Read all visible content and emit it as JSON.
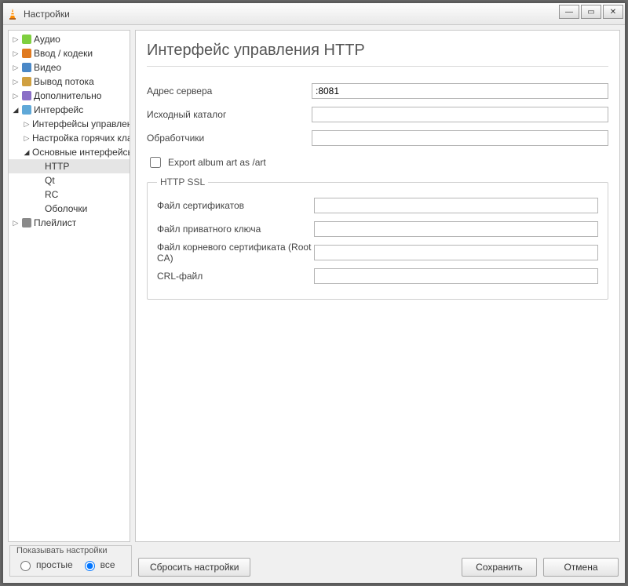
{
  "window": {
    "title": "Настройки"
  },
  "sysbuttons": {
    "min": "—",
    "max": "▭",
    "close": "✕"
  },
  "tree": {
    "audio": "Аудио",
    "input": "Ввод / кодеки",
    "video": "Видео",
    "sout": "Вывод потока",
    "advanced": "Дополнительно",
    "interface": "Интерфейс",
    "intf_sub1": "Интерфейсы управления",
    "intf_sub2": "Настройка горячих клавиш",
    "intf_sub3": "Основные интерфейсы",
    "http": "HTTP",
    "qt": "Qt",
    "rc": "RC",
    "skins": "Оболочки",
    "playlist": "Плейлист"
  },
  "page": {
    "title": "Интерфейс управления HTTP",
    "fields": {
      "server_addr_label": "Адрес сервера",
      "server_addr_value": ":8081",
      "src_dir_label": "Исходный каталог",
      "src_dir_value": "",
      "handlers_label": "Обработчики",
      "handlers_value": "",
      "export_art_label": "Export album art as /art"
    },
    "ssl": {
      "legend": "HTTP SSL",
      "cert_label": "Файл сертификатов",
      "cert_value": "",
      "key_label": "Файл приватного ключа",
      "key_value": "",
      "rootca_label": "Файл корневого сертификата (Root CA)",
      "rootca_value": "",
      "crl_label": "CRL-файл",
      "crl_value": ""
    }
  },
  "footer": {
    "show_label": "Показывать настройки",
    "simple_label": "простые",
    "all_label": "все",
    "reset": "Сбросить настройки",
    "save": "Сохранить",
    "cancel": "Отмена"
  }
}
